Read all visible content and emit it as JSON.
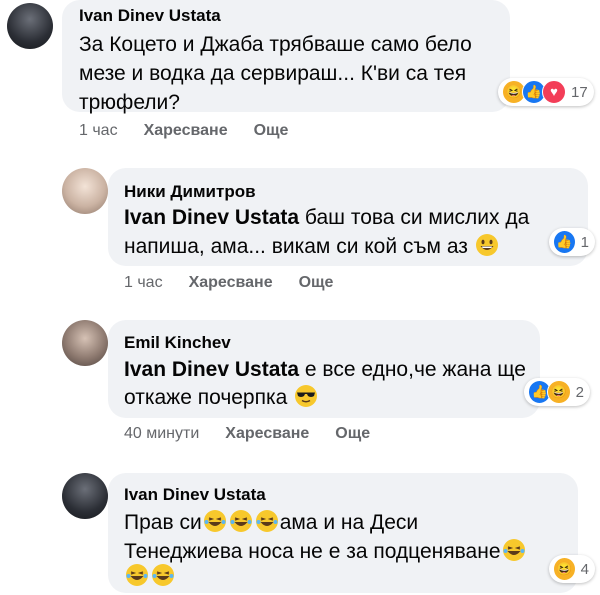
{
  "comments": [
    {
      "author": "Ivan Dinev Ustata",
      "mention": "",
      "lines": [
        "За Коцето и Джаба трябваше само бело",
        "мезе и водка да сервираш... К'ви са тея",
        "трюфели?"
      ],
      "time": "1 час",
      "like": "Харесване",
      "more": "Още",
      "reactions": [
        "haha",
        "like",
        "love"
      ],
      "reaction_count": "17"
    },
    {
      "author": "Ники Димитров",
      "mention": "Ivan Dinev Ustata",
      "lines": [
        " баш това си мислих да",
        "напиша, ама... викам си кой съм аз"
      ],
      "time": "1 час",
      "like": "Харесване",
      "more": "Още",
      "reactions": [
        "like"
      ],
      "reaction_count": "1"
    },
    {
      "author": "Emil Kinchev",
      "mention": "Ivan Dinev Ustata",
      "lines": [
        " е все едно,че жана ще",
        "откаже почерпка"
      ],
      "time": "40 минути",
      "like": "Харесване",
      "more": "Още",
      "reactions": [
        "like",
        "haha"
      ],
      "reaction_count": "2"
    },
    {
      "author": "Ivan Dinev Ustata",
      "mention": "",
      "lines": [
        "Прав си",
        "ама и на Деси",
        "Тенеджиева носа не е за подценяване"
      ],
      "reactions": [
        "haha"
      ],
      "reaction_count": "4"
    }
  ],
  "colors": {
    "bubble": "#f0f2f5",
    "meta": "#65676b",
    "like_blue": "#1877f2",
    "haha_yellow": "#f7b125",
    "love_red": "#f33e58"
  }
}
